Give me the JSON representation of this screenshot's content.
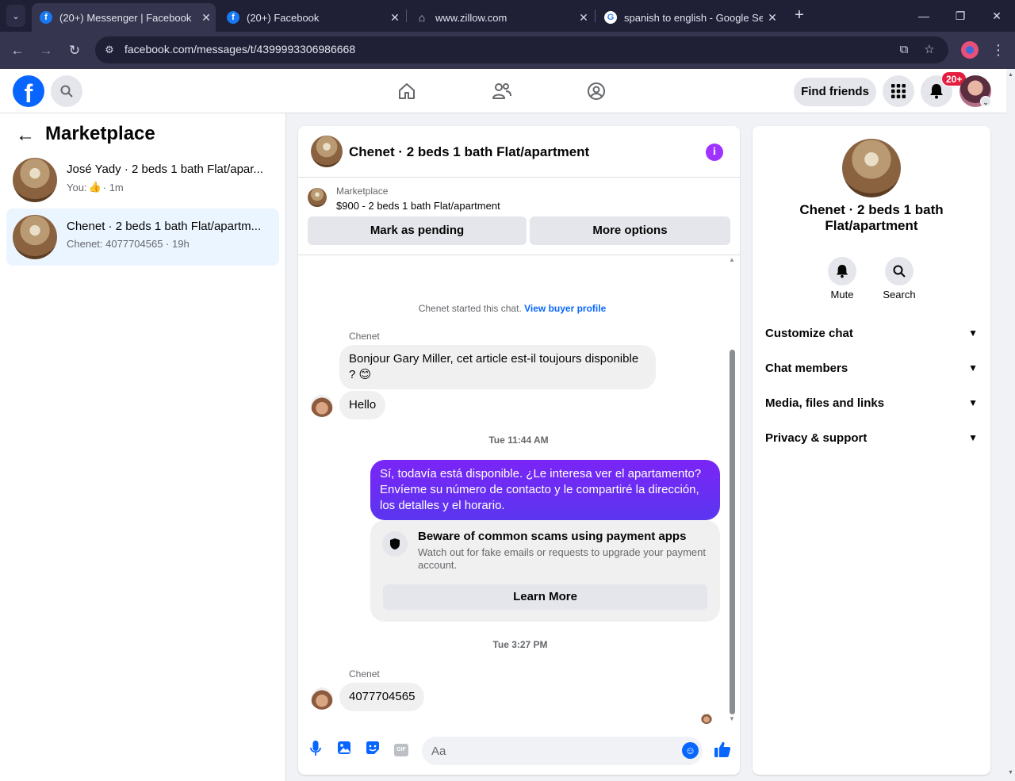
{
  "browser": {
    "tab_menu_icon": "chevron-down-icon",
    "tabs": [
      {
        "title": "(20+) Messenger | Facebook",
        "favicon": "facebook-icon",
        "active": true
      },
      {
        "title": "(20+) Facebook",
        "favicon": "facebook-icon",
        "active": false
      },
      {
        "title": "www.zillow.com",
        "favicon": "zillow-icon",
        "active": false
      },
      {
        "title": "spanish to english - Google Sea",
        "favicon": "google-icon",
        "active": false
      }
    ],
    "tab_close_glyph": "✕",
    "new_tab_glyph": "+",
    "window_controls": {
      "minimize": "—",
      "restore": "❐",
      "close": "✕"
    },
    "nav": {
      "back": "←",
      "forward": "→",
      "reload": "↻"
    },
    "url": "facebook.com/messages/t/4399993306986668"
  },
  "fb_nav": {
    "logo": "f",
    "find_friends": "Find friends",
    "notification_count": "20+"
  },
  "sidebar": {
    "title": "Marketplace",
    "conversations": [
      {
        "name": "José Yady · 2 beds 1 bath Flat/apar...",
        "sub_prefix": "You:",
        "sub_like": "👍",
        "sub_time": "· 1m",
        "selected": false
      },
      {
        "name": "Chenet · 2 beds 1 bath Flat/apartm...",
        "sub_prefix": "Chenet: 4077704565 · 19h",
        "selected": true
      }
    ]
  },
  "chat": {
    "title": "Chenet · 2 beds 1 bath Flat/apartment",
    "info_glyph": "i",
    "listing": {
      "source": "Marketplace",
      "price_line": "$900 - 2 beds 1 bath Flat/apartment",
      "mark_pending": "Mark as pending",
      "more_options": "More options"
    },
    "system_text": "Chenet started this chat.",
    "view_buyer_profile": "View buyer profile",
    "sender_1": "Chenet",
    "msg_1": "Bonjour Gary Miller, cet article est-il toujours disponible ? 😊",
    "msg_2": "Hello",
    "stamp_1": "Tue 11:44 AM",
    "msg_out": "Sí, todavía está disponible. ¿Le interesa ver el apartamento? Envíeme su número de contacto y le compartiré la dirección, los detalles y el horario.",
    "scam_title": "Beware of common scams using payment apps",
    "scam_body": "Watch out for fake emails or requests to upgrade your payment account.",
    "learn_more": "Learn More",
    "stamp_2": "Tue 3:27 PM",
    "sender_2": "Chenet",
    "msg_3": "4077704565",
    "composer_placeholder": "Aa",
    "gif_label": "GIF"
  },
  "right_panel": {
    "title": "Chenet · 2 beds 1 bath Flat/apartment",
    "mute": "Mute",
    "search": "Search",
    "sections": [
      "Customize chat",
      "Chat members",
      "Media, files and links",
      "Privacy & support"
    ]
  },
  "colors": {
    "brand": "#0866ff",
    "outgoing_bubble": "#6a2ff4",
    "info_icon": "#a033ff",
    "badge": "#e41e3f",
    "selected_row": "#ebf5ff"
  }
}
